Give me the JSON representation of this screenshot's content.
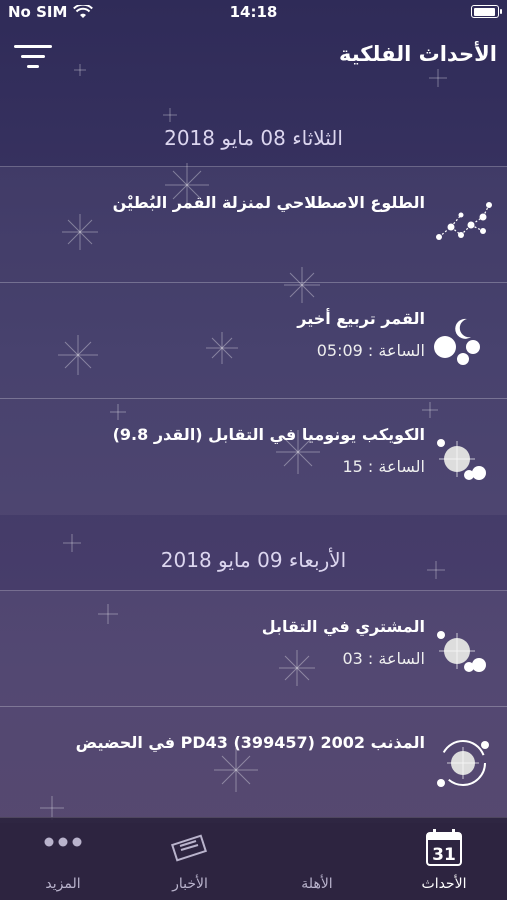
{
  "status": {
    "carrier": "No SIM",
    "time": "14:18"
  },
  "header": {
    "title": "الأحداث الفلكية"
  },
  "sections": [
    {
      "date": "الثلاثاء 08 مايو 2018",
      "events": [
        {
          "title": "الطلوع الاصطلاحي لمنزلة القمر البُطيْن",
          "time": "",
          "icon": "constellation-icon"
        },
        {
          "title": "القمر تربيع أخير",
          "time": "الساعة : 05:09",
          "icon": "moon-phase-icon"
        },
        {
          "title": "الكويكب يونوميا في التقابل (القدر 9.8)",
          "time": "الساعة : 15",
          "icon": "opposition-icon"
        }
      ]
    },
    {
      "date": "الأربعاء 09 مايو 2018",
      "events": [
        {
          "title": "المشتري في التقابل",
          "time": "الساعة : 03",
          "icon": "opposition-icon"
        },
        {
          "title": "المذنب 2002 (399457) PD43 في الحضيض",
          "time": "",
          "icon": "comet-perihelion-icon"
        }
      ]
    }
  ],
  "tabs": [
    {
      "label": "المزيد",
      "icon": "more-dots-icon"
    },
    {
      "label": "الأخبار",
      "icon": "news-icon"
    },
    {
      "label": "الأهلة",
      "icon": "crescent-moon-icon"
    },
    {
      "label": "الأحداث",
      "icon": "calendar-icon",
      "badge": "31"
    }
  ],
  "colors": {
    "background": "#3f3867",
    "accent": "#ffffff",
    "inactive_tab": "#b9b3cc"
  }
}
